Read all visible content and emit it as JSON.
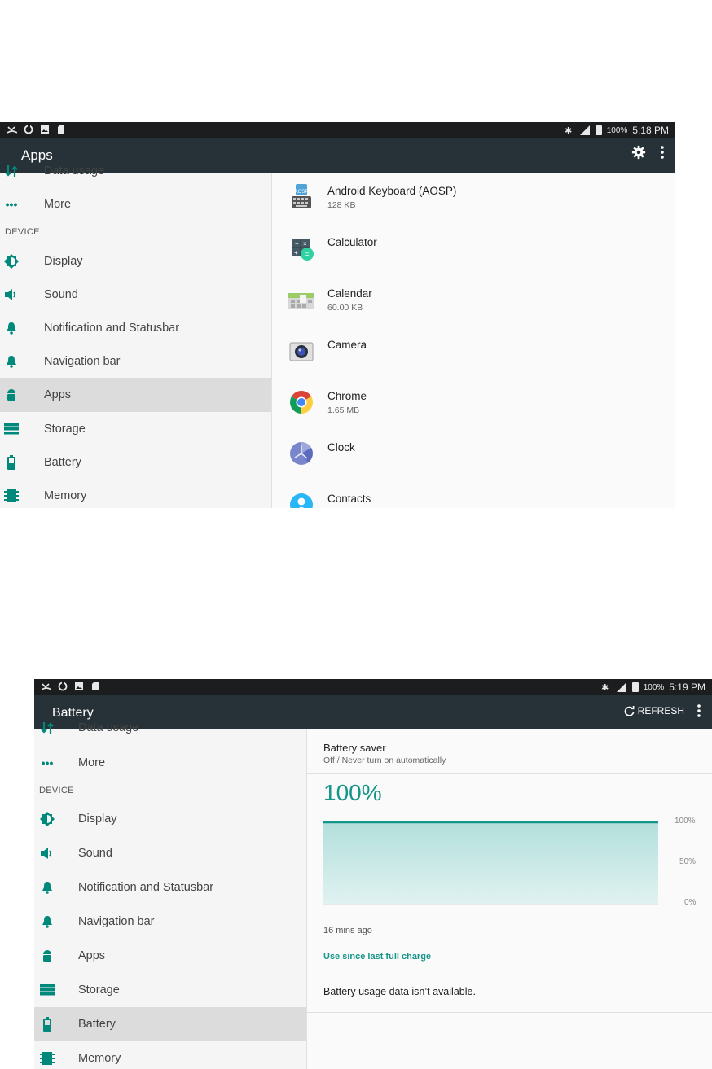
{
  "screen1": {
    "status": {
      "battery_pct": "100%",
      "time": "5:18 PM"
    },
    "appbar": {
      "title": "Apps"
    },
    "sidebar": {
      "items_before": [
        {
          "label": "Data usage",
          "icon": "data-usage-icon"
        },
        {
          "label": "More",
          "icon": "more-dots-icon"
        }
      ],
      "section_header": "DEVICE",
      "items": [
        {
          "label": "Display",
          "icon": "display-icon"
        },
        {
          "label": "Sound",
          "icon": "sound-icon"
        },
        {
          "label": "Notification and Statusbar",
          "icon": "bell-icon"
        },
        {
          "label": "Navigation bar",
          "icon": "bell-icon"
        },
        {
          "label": "Apps",
          "icon": "android-icon",
          "selected": true
        },
        {
          "label": "Storage",
          "icon": "storage-icon"
        },
        {
          "label": "Battery",
          "icon": "battery-icon"
        },
        {
          "label": "Memory",
          "icon": "memory-icon"
        }
      ]
    },
    "apps": [
      {
        "name": "Android Keyboard (AOSP)",
        "size": "128 KB",
        "icon": "keyboard-icon"
      },
      {
        "name": "Calculator",
        "size": "",
        "icon": "calculator-icon"
      },
      {
        "name": "Calendar",
        "size": "60.00 KB",
        "icon": "calendar-icon"
      },
      {
        "name": "Camera",
        "size": "",
        "icon": "camera-icon"
      },
      {
        "name": "Chrome",
        "size": "1.65 MB",
        "icon": "chrome-icon"
      },
      {
        "name": "Clock",
        "size": "",
        "icon": "clock-icon"
      },
      {
        "name": "Contacts",
        "size": "",
        "icon": "contacts-icon"
      }
    ]
  },
  "screen2": {
    "status": {
      "battery_pct": "100%",
      "time": "5:19 PM"
    },
    "appbar": {
      "title": "Battery",
      "refresh_label": "REFRESH"
    },
    "sidebar": {
      "items_before": [
        {
          "label": "Data usage",
          "icon": "data-usage-icon"
        },
        {
          "label": "More",
          "icon": "more-dots-icon"
        }
      ],
      "section_header": "DEVICE",
      "items": [
        {
          "label": "Display",
          "icon": "display-icon"
        },
        {
          "label": "Sound",
          "icon": "sound-icon"
        },
        {
          "label": "Notification and Statusbar",
          "icon": "bell-icon"
        },
        {
          "label": "Navigation bar",
          "icon": "bell-icon"
        },
        {
          "label": "Apps",
          "icon": "android-icon"
        },
        {
          "label": "Storage",
          "icon": "storage-icon"
        },
        {
          "label": "Battery",
          "icon": "battery-icon",
          "selected": true
        },
        {
          "label": "Memory",
          "icon": "memory-icon"
        }
      ]
    },
    "battery_saver": {
      "title": "Battery saver",
      "summary": "Off / Never turn on automatically"
    },
    "level": "100%",
    "chart": {
      "y_labels": [
        "100%",
        "50%",
        "0%"
      ],
      "time_label": "16 mins ago",
      "level_fraction": 1.0
    },
    "use_since_label": "Use since last full charge",
    "usage_message": "Battery usage data isn’t available."
  },
  "colors": {
    "accent": "#159688",
    "appbar": "#263238",
    "statusbar": "#1b1d1f",
    "icon_teal": "#00897b"
  }
}
